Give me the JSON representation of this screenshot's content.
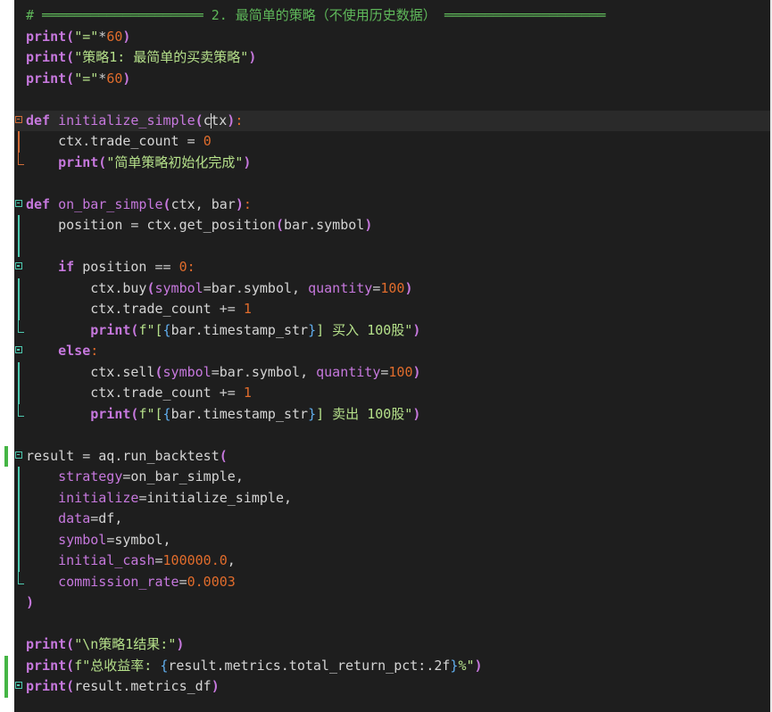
{
  "code_lines": [
    {
      "text": "# ════════════════════ 2. 最简单的策略（不使用历史数据） ════════════════════"
    },
    {
      "text": "print(\"=\"*60)"
    },
    {
      "text": "print(\"策略1: 最简单的买卖策略\")"
    },
    {
      "text": "print(\"=\"*60)"
    },
    {
      "text": ""
    },
    {
      "text": "def initialize_simple(ctx):"
    },
    {
      "text": "    ctx.trade_count = 0"
    },
    {
      "text": "    print(\"简单策略初始化完成\")"
    },
    {
      "text": ""
    },
    {
      "text": "def on_bar_simple(ctx, bar):"
    },
    {
      "text": "    position = ctx.get_position(bar.symbol)"
    },
    {
      "text": ""
    },
    {
      "text": "    if position == 0:"
    },
    {
      "text": "        ctx.buy(symbol=bar.symbol, quantity=100)"
    },
    {
      "text": "        ctx.trade_count += 1"
    },
    {
      "text": "        print(f\"[{bar.timestamp_str}] 买入 100股\")"
    },
    {
      "text": "    else:"
    },
    {
      "text": "        ctx.sell(symbol=bar.symbol, quantity=100)"
    },
    {
      "text": "        ctx.trade_count += 1"
    },
    {
      "text": "        print(f\"[{bar.timestamp_str}] 卖出 100股\")"
    },
    {
      "text": ""
    },
    {
      "text": "result = aq.run_backtest("
    },
    {
      "text": "    strategy=on_bar_simple,"
    },
    {
      "text": "    initialize=initialize_simple,"
    },
    {
      "text": "    data=df,"
    },
    {
      "text": "    symbol=symbol,"
    },
    {
      "text": "    initial_cash=100000.0,"
    },
    {
      "text": "    commission_rate=0.0003"
    },
    {
      "text": ")"
    },
    {
      "text": ""
    },
    {
      "text": "print(\"\\n策略1结果:\")"
    },
    {
      "text": "print(f\"总收益率: {result.metrics.total_return_pct:.2f}%\")"
    },
    {
      "text": "print(result.metrics_df)"
    }
  ],
  "colors": {
    "background": "#1e1e1e",
    "keyword": "#c678dd",
    "string": "#b5e08a",
    "number": "#e06c2c",
    "comment": "#5fb85a",
    "modified_bar": "#45b545",
    "fold_teal": "#4ec9b0",
    "fold_orange": "#d16d38"
  },
  "icons": [
    "fold-collapse-icon",
    "fold-guide-line",
    "modified-line-indicator"
  ]
}
